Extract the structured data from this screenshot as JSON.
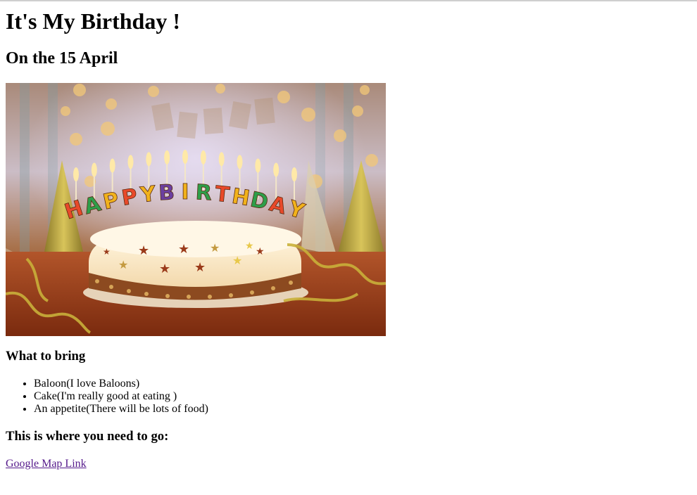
{
  "page": {
    "title": "It's My Birthday !",
    "date_heading": "On the 15 April",
    "bring_heading": "What to bring",
    "bring_items": [
      "Baloon(I love Baloons)",
      "Cake(I'm really good at eating )",
      "An appetite(There will be lots of food)"
    ],
    "where_heading": "This is where you need to go:",
    "map_link_label": "Google Map Link"
  },
  "image": {
    "candle_letters": [
      "H",
      "A",
      "P",
      "P",
      "Y",
      "B",
      "I",
      "R",
      "T",
      "H",
      "D",
      "A",
      "Y"
    ]
  },
  "colors": {
    "visited_link": "#551a8b"
  }
}
